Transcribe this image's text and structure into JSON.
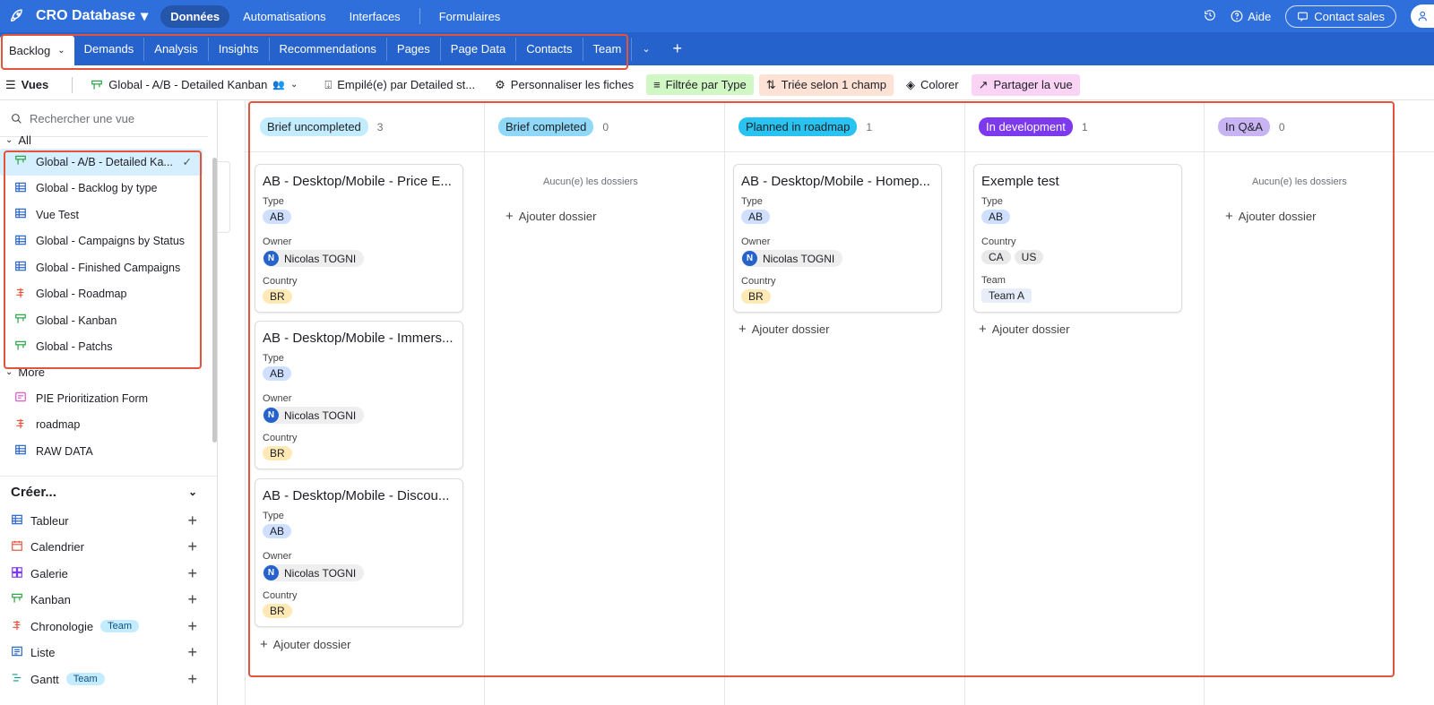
{
  "topbar": {
    "base_name": "CRO Database",
    "nav": [
      "Données",
      "Automatisations",
      "Interfaces",
      "Formulaires"
    ],
    "help": "Aide",
    "contact": "Contact sales"
  },
  "tabs": [
    "Backlog",
    "Demands",
    "Analysis",
    "Insights",
    "Recommendations",
    "Pages",
    "Page Data",
    "Contacts",
    "Team"
  ],
  "viewbar": {
    "views": "Vues",
    "current_view": "Global - A/B - Detailed Kanban",
    "stacked": "Empilé(e) par Detailed st...",
    "customize": "Personnaliser les fiches",
    "filter": "Filtrée par Type",
    "sort": "Triée selon 1 champ",
    "color": "Colorer",
    "share": "Partager la vue"
  },
  "sidebar": {
    "search_placeholder": "Rechercher une vue",
    "section_all": "All",
    "all_views": [
      {
        "label": "Global - A/B - Detailed Ka...",
        "icon": "kanban"
      },
      {
        "label": "Global - Backlog by type",
        "icon": "grid"
      },
      {
        "label": "Vue Test",
        "icon": "grid"
      },
      {
        "label": "Global - Campaigns by Status",
        "icon": "grid"
      },
      {
        "label": "Global - Finished Campaigns",
        "icon": "grid"
      },
      {
        "label": "Global - Roadmap",
        "icon": "timeline"
      },
      {
        "label": "Global - Kanban",
        "icon": "kanban"
      },
      {
        "label": "Global - Patchs",
        "icon": "kanban"
      }
    ],
    "section_more": "More",
    "more_views": [
      {
        "label": "PIE Prioritization Form",
        "icon": "form"
      },
      {
        "label": "roadmap",
        "icon": "timeline"
      },
      {
        "label": "RAW DATA",
        "icon": "grid"
      }
    ],
    "create_label": "Créer...",
    "create_items": [
      {
        "label": "Tableur",
        "badge": ""
      },
      {
        "label": "Calendrier",
        "badge": ""
      },
      {
        "label": "Galerie",
        "badge": ""
      },
      {
        "label": "Kanban",
        "badge": ""
      },
      {
        "label": "Chronologie",
        "badge": "Team"
      },
      {
        "label": "Liste",
        "badge": ""
      },
      {
        "label": "Gantt",
        "badge": "Team"
      }
    ]
  },
  "board": {
    "add_record": "Ajouter dossier",
    "empty_text": "Aucun(e) les dossiers",
    "field_type": "Type",
    "field_owner": "Owner",
    "field_country": "Country",
    "field_team": "Team",
    "columns": [
      {
        "name": "Brief uncompleted",
        "count": "3",
        "color": "#c4ecff",
        "text_color": "#1d1f25"
      },
      {
        "name": "Brief completed",
        "count": "0",
        "color": "#8fd8f7",
        "text_color": "#1d1f25"
      },
      {
        "name": "Planned in roadmap",
        "count": "1",
        "color": "#28c3f0",
        "text_color": "#1d1f25"
      },
      {
        "name": "In development",
        "count": "1",
        "color": "#7c39ed",
        "text_color": "#ffffff"
      },
      {
        "name": "In Q&A",
        "count": "0",
        "color": "#c9b4f3",
        "text_color": "#1d1f25"
      }
    ],
    "cards": [
      {
        "title": "AB - Desktop/Mobile - Price E...",
        "type": "AB",
        "owner": "Nicolas TOGNI",
        "owner_initial": "N",
        "country": "BR"
      },
      {
        "title": "AB - Desktop/Mobile - Immers...",
        "type": "AB",
        "owner": "Nicolas TOGNI",
        "owner_initial": "N",
        "country": "BR"
      },
      {
        "title": "AB - Desktop/Mobile - Discou...",
        "type": "AB",
        "owner": "Nicolas TOGNI",
        "owner_initial": "N",
        "country": "BR"
      },
      {
        "title": "AB - Desktop/Mobile - Homep...",
        "type": "AB",
        "owner": "Nicolas TOGNI",
        "owner_initial": "N",
        "country": "BR"
      },
      {
        "title": "Exemple test",
        "type": "AB",
        "country1": "CA",
        "country2": "US",
        "team": "Team A"
      }
    ]
  }
}
